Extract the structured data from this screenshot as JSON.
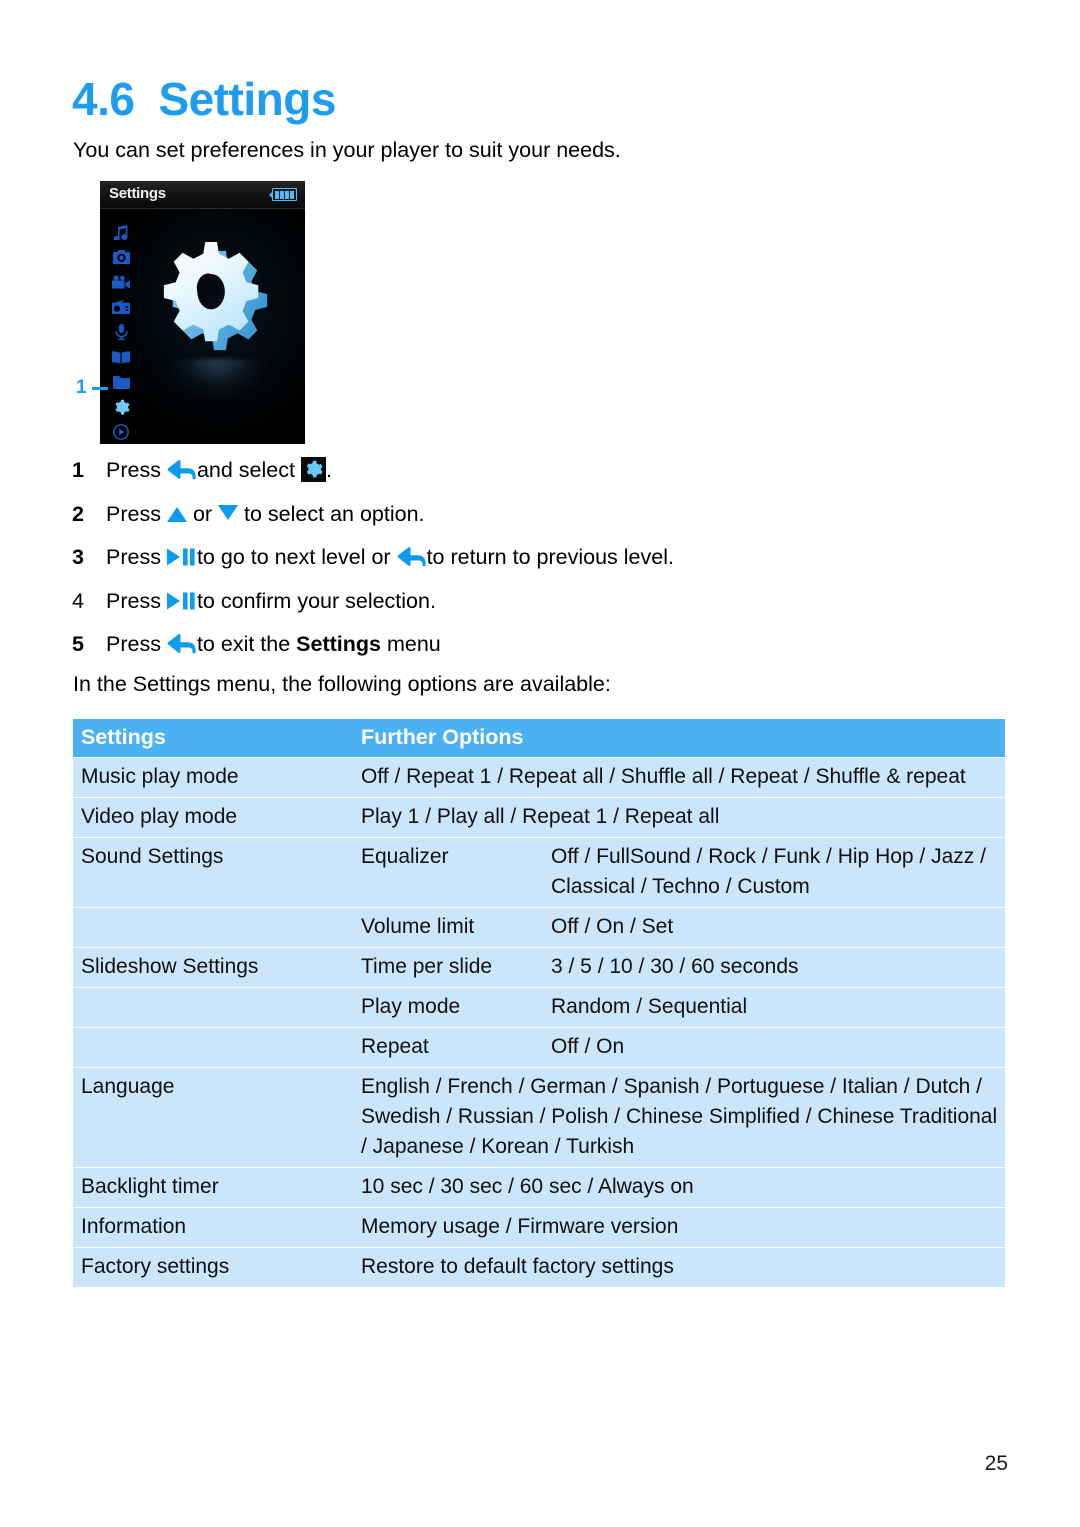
{
  "heading": {
    "number": "4.6",
    "title": "Settings"
  },
  "intro": "You can set preferences in your player to suit your needs.",
  "device": {
    "screen_title": "Settings",
    "battery_icon": "battery-full-icon",
    "callout_number": "1",
    "rail_icons": [
      "music-note-icon",
      "camera-icon",
      "video-camera-icon",
      "radio-icon",
      "microphone-icon",
      "book-icon",
      "folder-icon",
      "gear-icon",
      "play-circle-icon"
    ],
    "selected_rail_icon": "gear-icon",
    "main_graphic": "gear-icon"
  },
  "steps": [
    {
      "n": "1",
      "bold_number": true,
      "parts": [
        "Press ",
        "[back-icon]",
        " and select ",
        "[gear-box-icon]",
        "."
      ],
      "text": "Press  and select ."
    },
    {
      "n": "2",
      "bold_number": true,
      "text_a": "Press ",
      "text_b": " or ",
      "text_c": " to select an option."
    },
    {
      "n": "3",
      "bold_number": true,
      "text_a": "Press ",
      "text_b": " to go to next level or ",
      "text_c": " to return to previous level."
    },
    {
      "n": "4",
      "bold_number": false,
      "text_a": "Press ",
      "text_b": " to confirm your selection."
    },
    {
      "n": "5",
      "bold_number": true,
      "text_a": "Press ",
      "text_b": " to exit the ",
      "bold": "Settings",
      "text_c": " menu"
    }
  ],
  "available_line": "In the Settings menu, the following options are available:",
  "table": {
    "headers": [
      "Settings",
      "Further Options"
    ],
    "rows": [
      {
        "setting": "Music play mode",
        "sub": "",
        "options": "Off / Repeat 1 / Repeat all / Shuffle all / Repeat / Shuffle & repeat"
      },
      {
        "setting": "Video play mode",
        "sub": "",
        "options": "Play 1 / Play all / Repeat 1 / Repeat all"
      },
      {
        "setting": "Sound Settings",
        "sub": "Equalizer",
        "options": "Off / FullSound / Rock / Funk / Hip Hop / Jazz / Classical / Techno / Custom"
      },
      {
        "setting": "",
        "sub": "Volume limit",
        "options": "Off / On / Set"
      },
      {
        "setting": "Slideshow Settings",
        "sub": "Time per slide",
        "options": "3 / 5 / 10 / 30 / 60 seconds"
      },
      {
        "setting": "",
        "sub": "Play mode",
        "options": "Random / Sequential"
      },
      {
        "setting": "",
        "sub": "Repeat",
        "options": "Off / On"
      },
      {
        "setting": "Language",
        "sub": "",
        "options": "English / French / German / Spanish / Portuguese / Italian / Dutch / Swedish / Russian / Polish / Chinese Simplified / Chinese Traditional / Japanese / Korean / Turkish"
      },
      {
        "setting": "Backlight timer",
        "sub": "",
        "options": "10 sec / 30 sec / 60 sec / Always on"
      },
      {
        "setting": "Information",
        "sub": "",
        "options": "Memory usage / Firmware version"
      },
      {
        "setting": "Factory settings",
        "sub": "",
        "options": "Restore to default factory settings"
      }
    ]
  },
  "page_number": "25",
  "colors": {
    "accent_blue": "#1e9cf0",
    "table_header_blue": "#4cb1f0",
    "table_row_blue": "#cbe5fa",
    "icon_blue": "#0c9bee"
  },
  "step_text": {
    "s1_a": "Press",
    "s1_b": "and select",
    "s1_c": ".",
    "s2_a": "Press",
    "s2_b": "or",
    "s2_c": "to select an option.",
    "s3_a": "Press",
    "s3_b": "to go to next level or",
    "s3_c": "to return to previous level.",
    "s4_a": "Press",
    "s4_b": "to confirm your selection.",
    "s5_a": "Press",
    "s5_b": "to exit the",
    "s5_bold": "Settings",
    "s5_c": "menu"
  }
}
